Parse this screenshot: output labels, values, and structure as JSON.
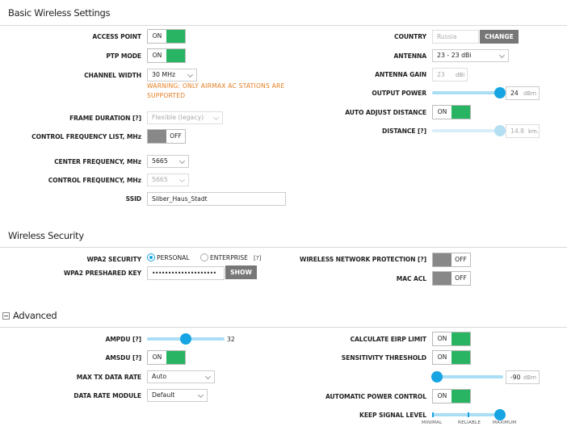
{
  "basic": {
    "title": "Basic Wireless Settings",
    "access_point": {
      "label": "ACCESS POINT",
      "state": "ON"
    },
    "ptp_mode": {
      "label": "PTP MODE",
      "state": "ON"
    },
    "channel_width": {
      "label": "CHANNEL WIDTH",
      "value": "30 MHz"
    },
    "warning": "WARNING: ONLY AIRMAX AC STATIONS ARE SUPPORTED",
    "frame_duration": {
      "label": "FRAME DURATION [?]",
      "value": "Flexible (legacy)"
    },
    "control_freq_list": {
      "label": "CONTROL FREQUENCY LIST, MHz",
      "state": "OFF"
    },
    "center_frequency": {
      "label": "CENTER FREQUENCY, MHz",
      "value": "5665"
    },
    "control_frequency": {
      "label": "CONTROL FREQUENCY, MHz",
      "value": "5665"
    },
    "ssid": {
      "label": "SSID",
      "value": "Silber_Haus_Stadt"
    },
    "country": {
      "label": "COUNTRY",
      "value": "Russia",
      "button": "CHANGE"
    },
    "antenna": {
      "label": "ANTENNA",
      "value": "23 - 23 dBi"
    },
    "antenna_gain": {
      "label": "ANTENNA GAIN",
      "value": "23",
      "unit": "dBi"
    },
    "output_power": {
      "label": "OUTPUT POWER",
      "value": "24",
      "unit": "dBm",
      "level": 1.0
    },
    "auto_adjust_distance": {
      "label": "AUTO ADJUST DISTANCE",
      "state": "ON"
    },
    "distance": {
      "label": "DISTANCE [?]",
      "value": "14.8",
      "unit": "km.",
      "level": 1.0
    }
  },
  "security": {
    "title": "Wireless Security",
    "wpa2": {
      "label": "WPA2 SECURITY",
      "options": [
        "PERSONAL",
        "ENTERPRISE"
      ],
      "selected": "PERSONAL",
      "help": "[?]"
    },
    "psk": {
      "label": "WPA2 PRESHARED KEY",
      "value": "••••••••••••••••••••",
      "button": "SHOW"
    },
    "wnp": {
      "label": "WIRELESS NETWORK PROTECTION [?]",
      "state": "OFF"
    },
    "mac_acl": {
      "label": "MAC ACL",
      "state": "OFF"
    }
  },
  "advanced": {
    "title": "Advanced",
    "ampdu": {
      "label": "AMPDU [?]",
      "value": "32",
      "level": 0.5
    },
    "amsdu": {
      "label": "AMSDU [?]",
      "state": "ON"
    },
    "max_tx_rate": {
      "label": "MAX TX DATA RATE",
      "value": "Auto"
    },
    "data_rate_module": {
      "label": "DATA RATE MODULE",
      "value": "Default"
    },
    "calc_eirp": {
      "label": "CALCULATE EIRP LIMIT",
      "state": "ON"
    },
    "sensitivity": {
      "label": "SENSITIVITY THRESHOLD",
      "state": "ON",
      "value": "-90",
      "unit": "dBm",
      "level": 0.0
    },
    "auto_power": {
      "label": "AUTOMATIC POWER CONTROL",
      "state": "ON"
    },
    "keep_signal": {
      "label": "KEEP SIGNAL LEVEL",
      "ticks": [
        "MINIMAL",
        "RELIABLE",
        "MAXIMUM"
      ],
      "level": 1.0
    }
  }
}
